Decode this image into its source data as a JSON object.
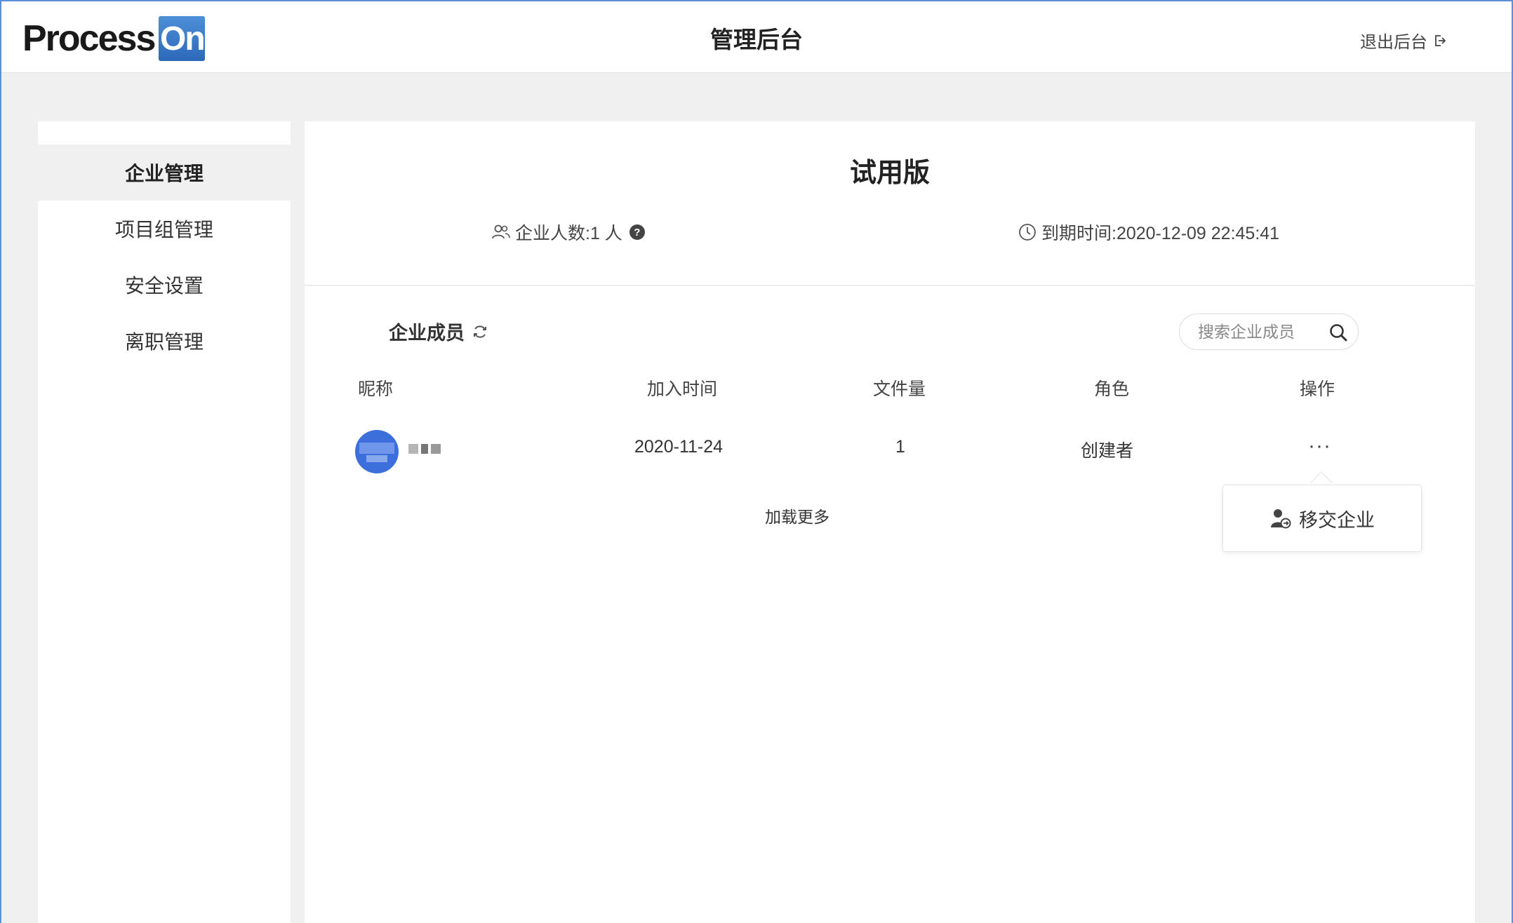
{
  "header": {
    "logo_part1": "Process",
    "logo_part2": "On",
    "title": "管理后台",
    "logout_label": "退出后台"
  },
  "sidebar": {
    "items": [
      {
        "label": "企业管理",
        "active": true
      },
      {
        "label": "项目组管理",
        "active": false
      },
      {
        "label": "安全设置",
        "active": false
      },
      {
        "label": "离职管理",
        "active": false
      }
    ]
  },
  "plan": {
    "title": "试用版",
    "member_count_label": "企业人数:1 人",
    "help_glyph": "?",
    "expire_label": "到期时间:2020-12-09 22:45:41"
  },
  "members": {
    "title": "企业成员",
    "search_placeholder": "搜索企业成员",
    "columns": [
      "昵称",
      "加入时间",
      "文件量",
      "角色",
      "操作"
    ],
    "rows": [
      {
        "nickname": "",
        "join_date": "2020-11-24",
        "file_count": "1",
        "role": "创建者",
        "action": "···"
      }
    ],
    "load_more": "加载更多"
  },
  "action_menu": {
    "items": [
      {
        "label": "移交企业",
        "icon": "transfer-user-icon"
      }
    ]
  },
  "colors": {
    "brand_blue": "#3a7bd5",
    "background": "#f0f0f0",
    "avatar_blue": "#3d6fdc"
  }
}
